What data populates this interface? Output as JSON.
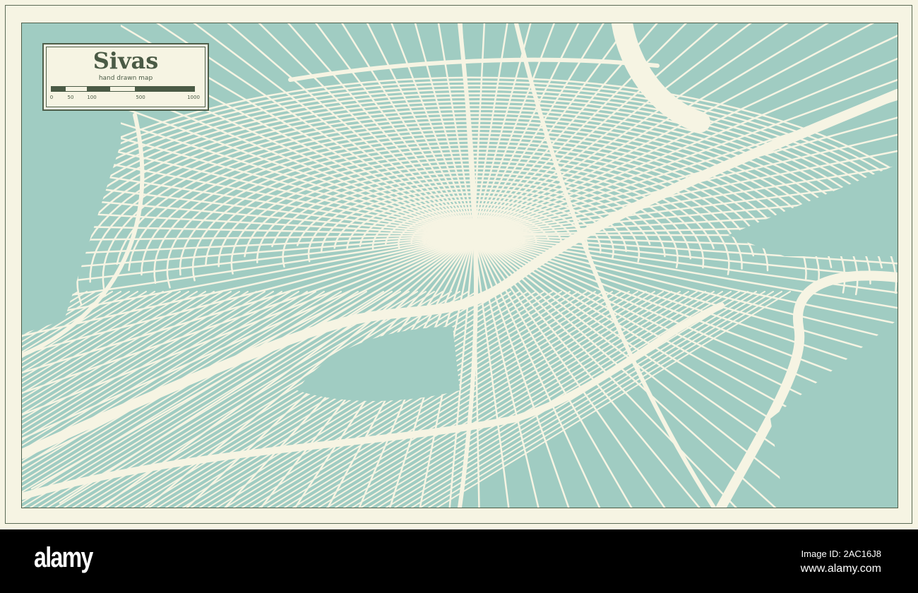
{
  "map": {
    "title": "Sivas",
    "subtitle": "hand drawn map",
    "scale_ticks": [
      "0",
      "50",
      "100",
      "500",
      "1000"
    ],
    "colors": {
      "water": "#a0ccc2",
      "roads": "#f6f4e3",
      "ink": "#4a5a45"
    }
  },
  "footer": {
    "logo": "alamy",
    "image_id": "Image ID: 2AC16J8",
    "url": "www.alamy.com"
  }
}
